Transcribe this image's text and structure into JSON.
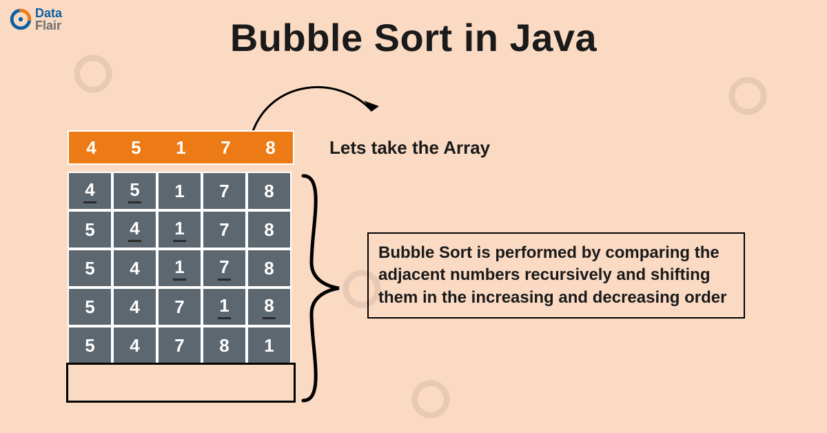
{
  "logo": {
    "data": "Data",
    "flair": "Flair"
  },
  "title": "Bubble Sort in Java",
  "array_label": "Lets take the Array",
  "header_row": [
    "4",
    "5",
    "1",
    "7",
    "8"
  ],
  "rows": [
    {
      "values": [
        "4",
        "5",
        "1",
        "7",
        "8"
      ],
      "underline": [
        0,
        1
      ]
    },
    {
      "values": [
        "5",
        "4",
        "1",
        "7",
        "8"
      ],
      "underline": [
        1,
        2
      ]
    },
    {
      "values": [
        "5",
        "4",
        "1",
        "7",
        "8"
      ],
      "underline": [
        2,
        3
      ]
    },
    {
      "values": [
        "5",
        "4",
        "7",
        "1",
        "8"
      ],
      "underline": [
        3,
        4
      ]
    },
    {
      "values": [
        "5",
        "4",
        "7",
        "8",
        "1"
      ],
      "underline": []
    }
  ],
  "description": "Bubble Sort is performed by comparing the adjacent numbers recursively and shifting them in the increasing and decreasing order"
}
